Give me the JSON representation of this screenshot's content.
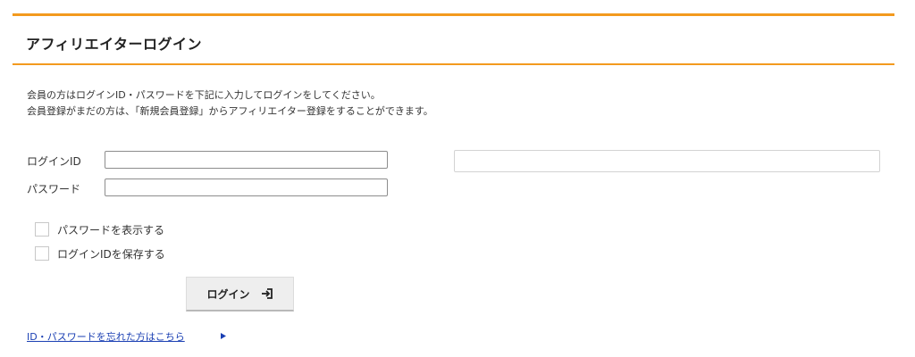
{
  "page": {
    "title": "アフィリエイターログイン"
  },
  "intro": {
    "line1": "会員の方はログインID・パスワードを下記に入力してログインをしてください。",
    "line2": "会員登録がまだの方は、「新規会員登録」からアフィリエイター登録をすることができます。"
  },
  "form": {
    "login_id_label": "ログインID",
    "login_id_value": "",
    "password_label": "パスワード",
    "password_value": ""
  },
  "options": {
    "show_password_label": "パスワードを表示する",
    "show_password_checked": false,
    "save_login_id_label": "ログインIDを保存する",
    "save_login_id_checked": false
  },
  "actions": {
    "login_button_label": "ログイン",
    "login_icon": "login-icon"
  },
  "links": {
    "forgot_label": "ID・パスワードを忘れた方はこちら",
    "forgot_icon": "triangle-right-icon"
  },
  "colors": {
    "accent": "#f39a1e",
    "link": "#1a3fb3"
  }
}
